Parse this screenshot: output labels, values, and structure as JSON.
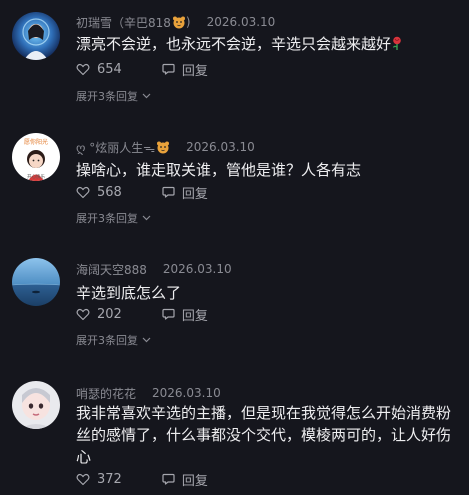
{
  "reply_label": "回复",
  "comments": [
    {
      "username": "初瑞雪（辛巴818",
      "date": "2026.03.10",
      "text": "漂亮不会逆，也永远不会逆，辛选只会越来越好",
      "likes": "654",
      "expand": "展开3条回复",
      "badge_icon": "tiger-emoji-icon",
      "trailing_icon": "rose-emoji-icon"
    },
    {
      "username": "ღ °炫丽人生ᯓ",
      "date": "2026.03.10",
      "text": "操啥心，谁走取关谁，管他是谁？人各有志",
      "likes": "568",
      "expand": "展开3条回复",
      "badge_icon": "tiger-emoji-icon"
    },
    {
      "username": "海阔天空888",
      "date": "2026.03.10",
      "text": "辛选到底怎么了",
      "likes": "202",
      "expand": "展开3条回复"
    },
    {
      "username": "哨瑟的花花",
      "date": "2026.03.10",
      "text": "我非常喜欢辛选的主播，但是现在我觉得怎么开始消费粉丝的感情了，什么事都没个交代，模棱两可的，让人好伤心",
      "likes": "372"
    }
  ],
  "colors": {
    "background": "#15161d",
    "text": "#eeeef0",
    "meta": "#8a8b93"
  }
}
